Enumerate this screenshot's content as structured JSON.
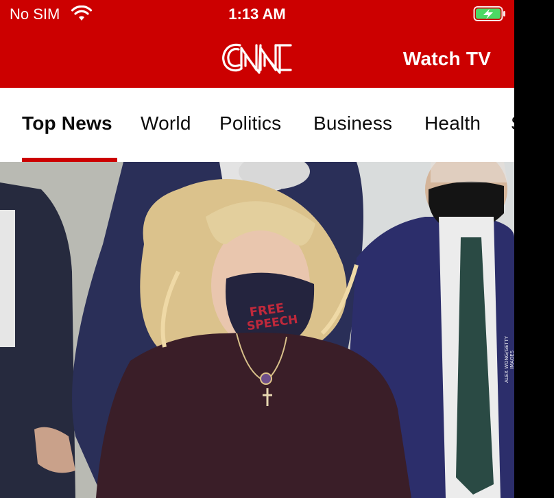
{
  "status_bar": {
    "carrier": "No SIM",
    "time": "1:13 AM",
    "wifi_icon": "wifi-icon",
    "battery_icon": "battery-charging-icon",
    "battery_color": "#4cd964"
  },
  "header": {
    "brand_color": "#cc0000",
    "logo_text": "CNN",
    "watch_tv_label": "Watch TV"
  },
  "tabs": [
    {
      "label": "Top News",
      "active": true
    },
    {
      "label": "World",
      "active": false
    },
    {
      "label": "Politics",
      "active": false
    },
    {
      "label": "Business",
      "active": false
    },
    {
      "label": "Health",
      "active": false
    },
    {
      "label": "S",
      "active": false
    }
  ],
  "hero": {
    "mask_text_line1": "FREE",
    "mask_text_line2": "SPEECH",
    "photo_credit": "ALEX WONG/GETTY IMAGES"
  }
}
